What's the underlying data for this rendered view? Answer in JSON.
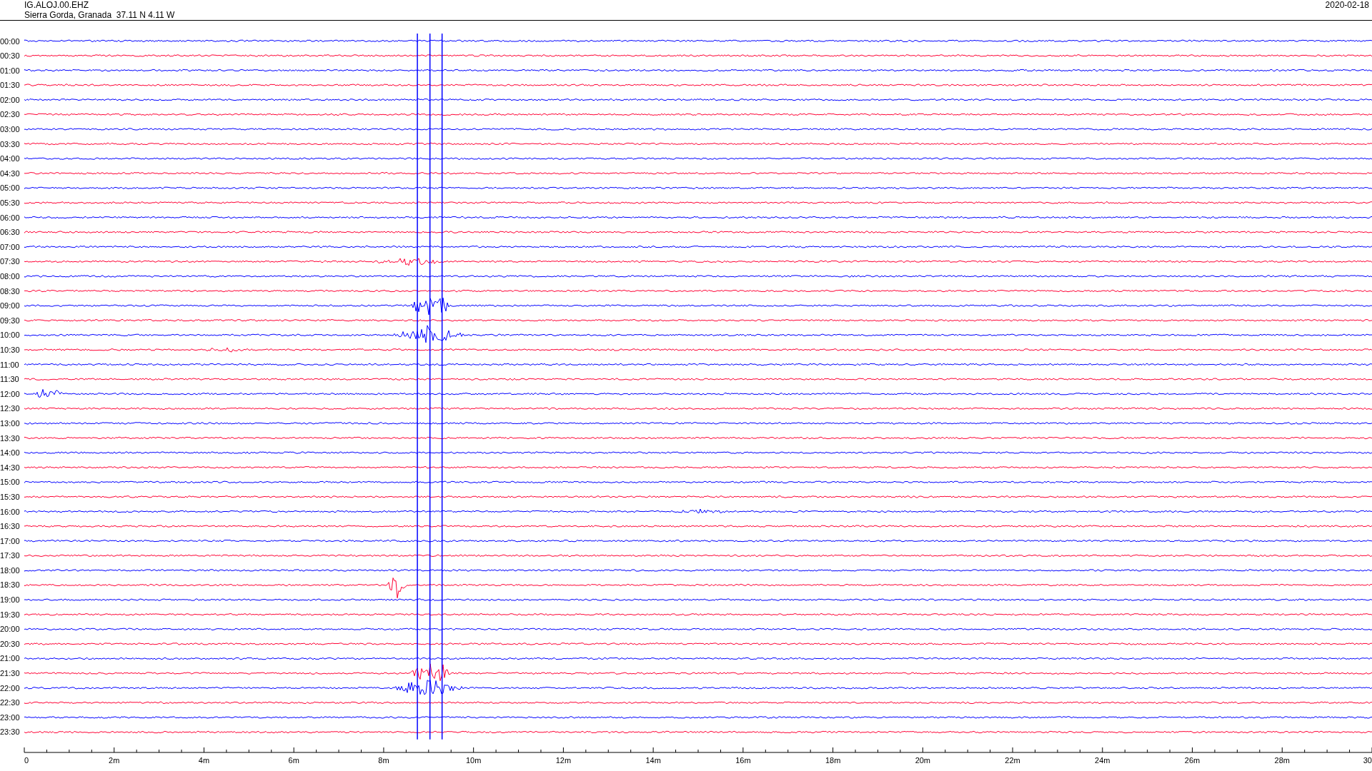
{
  "header": {
    "channel": "IG.ALOJ.00.EHZ",
    "location": "Sierra Gorda, Granada  37.11 N 4.11 W",
    "date": "2020-02-18"
  },
  "rows": [
    {
      "label": "00:00",
      "color": "#0000ff"
    },
    {
      "label": "00:30",
      "color": "#ff0033"
    },
    {
      "label": "01:00",
      "color": "#0000ff"
    },
    {
      "label": "01:30",
      "color": "#ff0033"
    },
    {
      "label": "02:00",
      "color": "#0000ff"
    },
    {
      "label": "02:30",
      "color": "#ff0033"
    },
    {
      "label": "03:00",
      "color": "#0000ff"
    },
    {
      "label": "03:30",
      "color": "#ff0033"
    },
    {
      "label": "04:00",
      "color": "#0000ff"
    },
    {
      "label": "04:30",
      "color": "#ff0033"
    },
    {
      "label": "05:00",
      "color": "#0000ff"
    },
    {
      "label": "05:30",
      "color": "#ff0033"
    },
    {
      "label": "06:00",
      "color": "#0000ff"
    },
    {
      "label": "06:30",
      "color": "#ff0033"
    },
    {
      "label": "07:00",
      "color": "#0000ff"
    },
    {
      "label": "07:30",
      "color": "#ff0033"
    },
    {
      "label": "08:00",
      "color": "#0000ff"
    },
    {
      "label": "08:30",
      "color": "#ff0033"
    },
    {
      "label": "09:00",
      "color": "#0000ff"
    },
    {
      "label": "09:30",
      "color": "#ff0033"
    },
    {
      "label": "10:00",
      "color": "#0000ff"
    },
    {
      "label": "10:30",
      "color": "#ff0033"
    },
    {
      "label": "11:00",
      "color": "#0000ff"
    },
    {
      "label": "11:30",
      "color": "#ff0033"
    },
    {
      "label": "12:00",
      "color": "#0000ff"
    },
    {
      "label": "12:30",
      "color": "#ff0033"
    },
    {
      "label": "13:00",
      "color": "#0000ff"
    },
    {
      "label": "13:30",
      "color": "#ff0033"
    },
    {
      "label": "14:00",
      "color": "#0000ff"
    },
    {
      "label": "14:30",
      "color": "#ff0033"
    },
    {
      "label": "15:00",
      "color": "#0000ff"
    },
    {
      "label": "15:30",
      "color": "#ff0033"
    },
    {
      "label": "16:00",
      "color": "#0000ff"
    },
    {
      "label": "16:30",
      "color": "#ff0033"
    },
    {
      "label": "17:00",
      "color": "#0000ff"
    },
    {
      "label": "17:30",
      "color": "#ff0033"
    },
    {
      "label": "18:00",
      "color": "#0000ff"
    },
    {
      "label": "18:30",
      "color": "#ff0033"
    },
    {
      "label": "19:00",
      "color": "#0000ff"
    },
    {
      "label": "19:30",
      "color": "#ff0033"
    },
    {
      "label": "20:00",
      "color": "#0000ff"
    },
    {
      "label": "20:30",
      "color": "#ff0033"
    },
    {
      "label": "21:00",
      "color": "#0000ff"
    },
    {
      "label": "21:30",
      "color": "#ff0033"
    },
    {
      "label": "22:00",
      "color": "#0000ff"
    },
    {
      "label": "22:30",
      "color": "#ff0033"
    },
    {
      "label": "23:00",
      "color": "#0000ff"
    },
    {
      "label": "23:30",
      "color": "#ff0033"
    }
  ],
  "x_axis": {
    "ticks": [
      "0",
      "2m",
      "4m",
      "6m",
      "8m",
      "10m",
      "12m",
      "14m",
      "16m",
      "18m",
      "20m",
      "22m",
      "24m",
      "26m",
      "28m",
      "30"
    ]
  }
}
